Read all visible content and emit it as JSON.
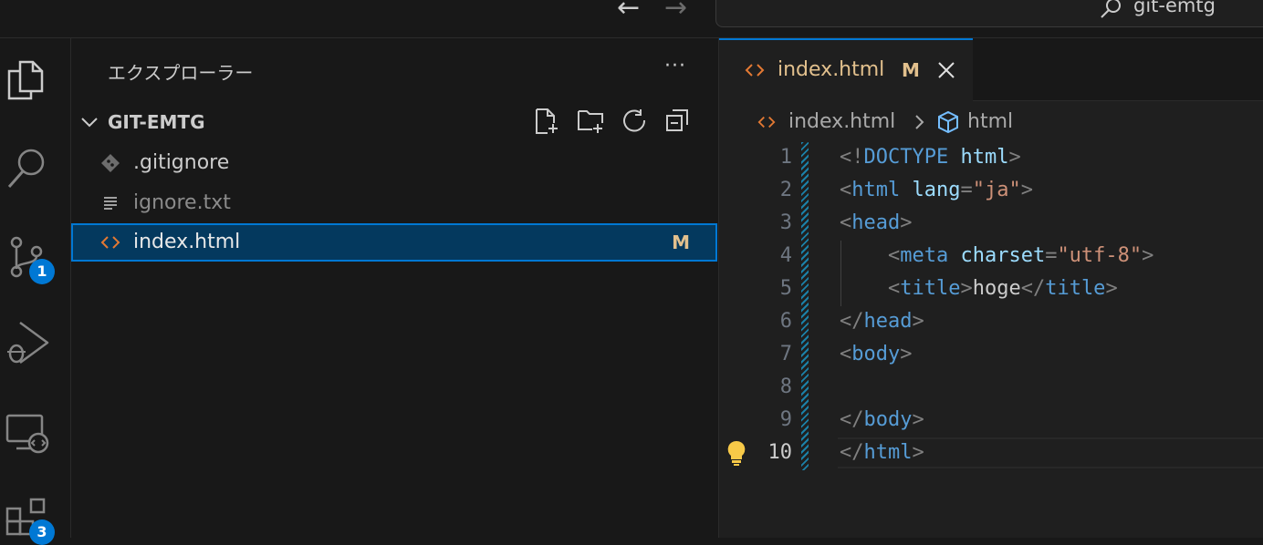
{
  "titlebar": {
    "back_label": "←",
    "forward_label": "→",
    "search_text": "git-emtg"
  },
  "activity": {
    "scm_badge": "1",
    "extensions_badge": "3"
  },
  "explorer": {
    "title": "エクスプローラー",
    "more": "···",
    "folder": "GIT-EMTG",
    "files": [
      {
        "name": ".gitignore",
        "status": "",
        "color": "#cccccc"
      },
      {
        "name": "ignore.txt",
        "status": "",
        "color": "#8b8b8b"
      },
      {
        "name": "index.html",
        "status": "M",
        "color": "#e8e8e8"
      }
    ]
  },
  "editor": {
    "tab": {
      "label": "index.html",
      "status": "M"
    },
    "breadcrumb": {
      "file": "index.html",
      "symbol": "html"
    },
    "line_numbers": [
      "1",
      "2",
      "3",
      "4",
      "5",
      "6",
      "7",
      "8",
      "9",
      "10"
    ],
    "lines": [
      {
        "indent": "",
        "parts": [
          [
            "p",
            "<!"
          ],
          [
            "t",
            "DOCTYPE"
          ],
          [
            "p",
            " "
          ],
          [
            "a",
            "html"
          ],
          [
            "p",
            ">"
          ]
        ]
      },
      {
        "indent": "",
        "parts": [
          [
            "p",
            "<"
          ],
          [
            "t",
            "html"
          ],
          [
            "p",
            " "
          ],
          [
            "a",
            "lang"
          ],
          [
            "p",
            "="
          ],
          [
            "s",
            "\"ja\""
          ],
          [
            "p",
            ">"
          ]
        ]
      },
      {
        "indent": "",
        "parts": [
          [
            "p",
            "<"
          ],
          [
            "t",
            "head"
          ],
          [
            "p",
            ">"
          ]
        ]
      },
      {
        "indent": "    ",
        "parts": [
          [
            "p",
            "<"
          ],
          [
            "t",
            "meta"
          ],
          [
            "p",
            " "
          ],
          [
            "a",
            "charset"
          ],
          [
            "p",
            "="
          ],
          [
            "s",
            "\"utf-8\""
          ],
          [
            "p",
            ">"
          ]
        ]
      },
      {
        "indent": "    ",
        "parts": [
          [
            "p",
            "<"
          ],
          [
            "t",
            "title"
          ],
          [
            "p",
            ">"
          ],
          [
            "x",
            "hoge"
          ],
          [
            "p",
            "</"
          ],
          [
            "t",
            "title"
          ],
          [
            "p",
            ">"
          ]
        ]
      },
      {
        "indent": "",
        "parts": [
          [
            "p",
            "</"
          ],
          [
            "t",
            "head"
          ],
          [
            "p",
            ">"
          ]
        ]
      },
      {
        "indent": "",
        "parts": [
          [
            "p",
            "<"
          ],
          [
            "t",
            "body"
          ],
          [
            "p",
            ">"
          ]
        ]
      },
      {
        "indent": "",
        "parts": []
      },
      {
        "indent": "",
        "parts": [
          [
            "p",
            "</"
          ],
          [
            "t",
            "body"
          ],
          [
            "p",
            ">"
          ]
        ]
      },
      {
        "indent": "",
        "parts": [
          [
            "p",
            "</"
          ],
          [
            "t",
            "html"
          ],
          [
            "p",
            ">"
          ]
        ]
      }
    ]
  },
  "colors": {
    "accent": "#0078d4",
    "modified": "#e2c08d",
    "html_icon": "#e37933",
    "tag": "#569cd6",
    "attr": "#9cdcfe",
    "string": "#ce9178"
  }
}
